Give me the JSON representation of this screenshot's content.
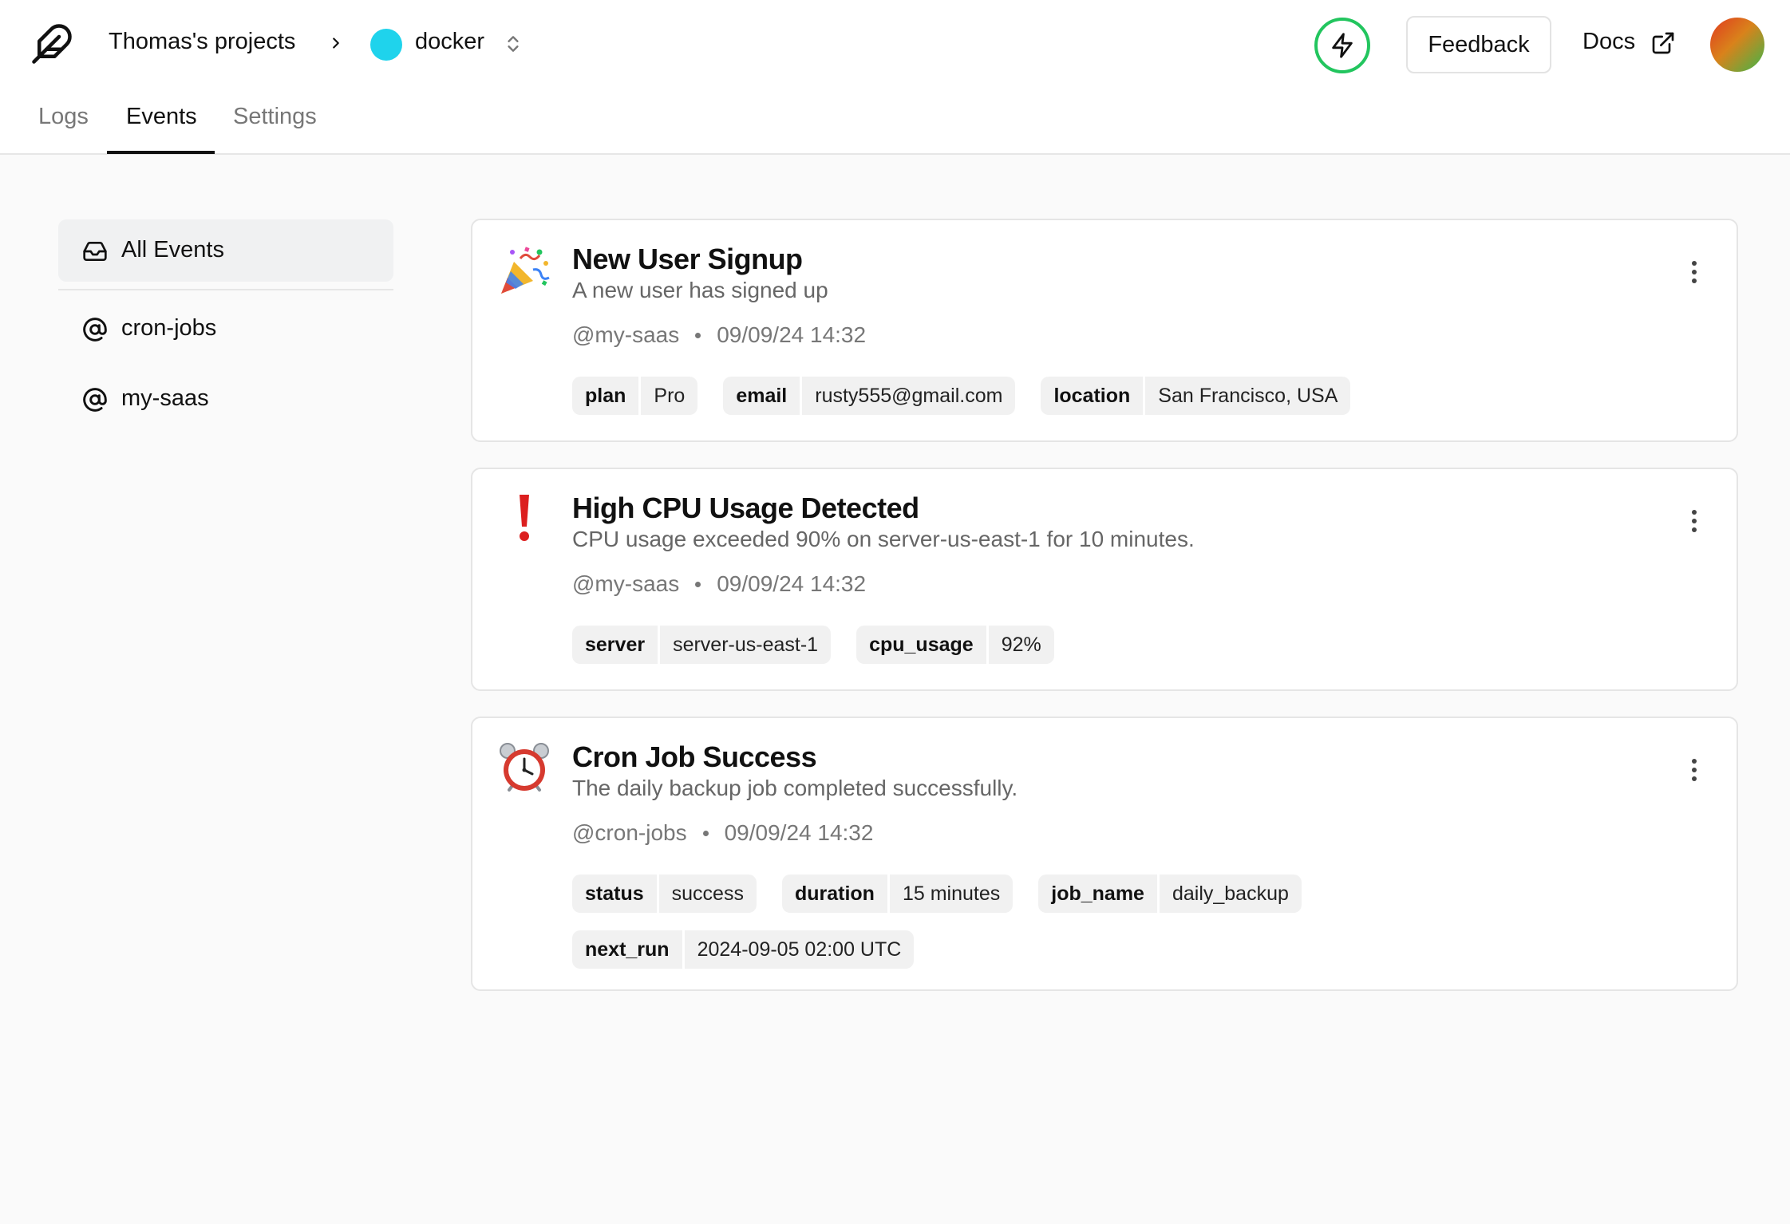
{
  "header": {
    "project": "Thomas's projects",
    "selected_project": "docker",
    "feedback_label": "Feedback",
    "docs_label": "Docs",
    "colors": {
      "project_dot": "#1fd3ec",
      "bolt_ring": "#22c55e"
    }
  },
  "tabs": [
    {
      "label": "Logs",
      "active": false
    },
    {
      "label": "Events",
      "active": true
    },
    {
      "label": "Settings",
      "active": false
    }
  ],
  "sidebar": {
    "items": [
      {
        "label": "All Events",
        "icon": "inbox-icon",
        "active": true
      },
      {
        "label": "cron-jobs",
        "icon": "at-icon",
        "active": false
      },
      {
        "label": "my-saas",
        "icon": "at-icon",
        "active": false
      }
    ]
  },
  "events": [
    {
      "icon": "party-popper-icon",
      "title": "New User Signup",
      "description": "A new user has signed up",
      "channel": "@my-saas",
      "timestamp": "09/09/24 14:32",
      "tags": [
        {
          "key": "plan",
          "value": "Pro"
        },
        {
          "key": "email",
          "value": "rusty555@gmail.com"
        },
        {
          "key": "location",
          "value": "San Francisco, USA"
        }
      ]
    },
    {
      "icon": "exclamation-icon",
      "title": "High CPU Usage Detected",
      "description": "CPU usage exceeded 90% on server-us-east-1 for 10 minutes.",
      "channel": "@my-saas",
      "timestamp": "09/09/24 14:32",
      "tags": [
        {
          "key": "server",
          "value": "server-us-east-1"
        },
        {
          "key": "cpu_usage",
          "value": "92%"
        }
      ]
    },
    {
      "icon": "alarm-clock-icon",
      "title": "Cron Job Success",
      "description": "The daily backup job completed successfully.",
      "channel": "@cron-jobs",
      "timestamp": "09/09/24 14:32",
      "tags": [
        {
          "key": "status",
          "value": "success"
        },
        {
          "key": "duration",
          "value": "15 minutes"
        },
        {
          "key": "job_name",
          "value": "daily_backup"
        },
        {
          "key": "next_run",
          "value": "2024-09-05 02:00 UTC"
        }
      ]
    }
  ]
}
